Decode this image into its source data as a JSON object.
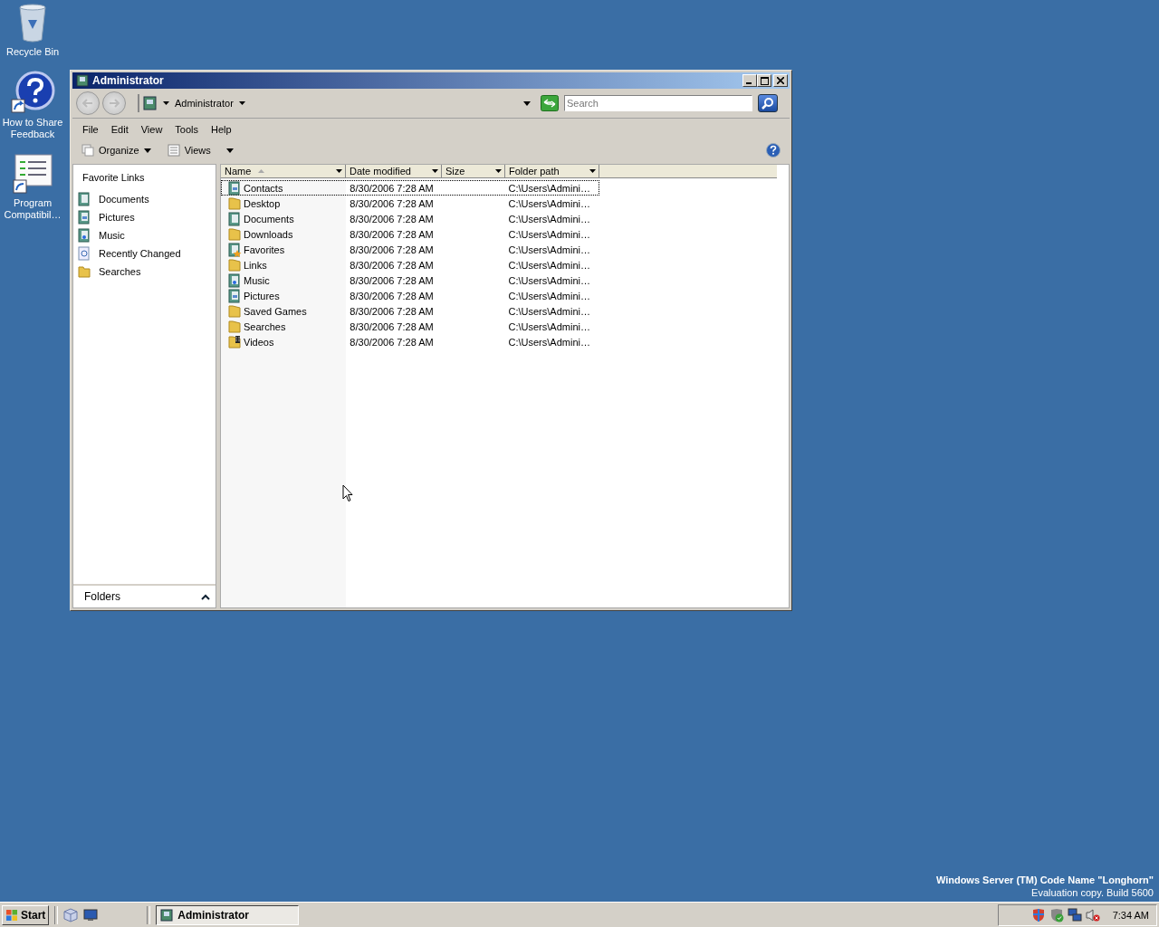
{
  "desktop_icons": [
    {
      "label": "Recycle Bin",
      "kind": "recycle"
    },
    {
      "label": "How to Share Feedback",
      "kind": "help"
    },
    {
      "label": "Program Compatibil…",
      "kind": "program"
    }
  ],
  "window": {
    "title": "Administrator",
    "address": {
      "crumb": "Administrator"
    },
    "search": {
      "placeholder": "Search"
    },
    "menu": [
      "File",
      "Edit",
      "View",
      "Tools",
      "Help"
    ],
    "toolbar": [
      "Organize",
      "Views"
    ],
    "favorite_links": {
      "title": "Favorite Links",
      "items": [
        {
          "label": "Documents",
          "kind": "documents"
        },
        {
          "label": "Pictures",
          "kind": "pictures"
        },
        {
          "label": "Music",
          "kind": "music"
        },
        {
          "label": "Recently Changed",
          "kind": "recent"
        },
        {
          "label": "Searches",
          "kind": "folder"
        }
      ]
    },
    "folders_panel": "Folders",
    "table": {
      "columns": [
        {
          "label": "Name",
          "sorted": true
        },
        {
          "label": "Date modified",
          "sorted": false
        },
        {
          "label": "Size",
          "sorted": false
        },
        {
          "label": "Folder path",
          "sorted": false
        }
      ],
      "rows": [
        {
          "name": "Contacts",
          "kind": "contacts",
          "date": "8/30/2006 7:28 AM",
          "path": "C:\\Users\\Admini…",
          "focused": true
        },
        {
          "name": "Desktop",
          "kind": "folder",
          "date": "8/30/2006 7:28 AM",
          "path": "C:\\Users\\Admini…",
          "focused": false
        },
        {
          "name": "Documents",
          "kind": "documents",
          "date": "8/30/2006 7:28 AM",
          "path": "C:\\Users\\Admini…",
          "focused": false
        },
        {
          "name": "Downloads",
          "kind": "folder",
          "date": "8/30/2006 7:28 AM",
          "path": "C:\\Users\\Admini…",
          "focused": false
        },
        {
          "name": "Favorites",
          "kind": "favorites",
          "date": "8/30/2006 7:28 AM",
          "path": "C:\\Users\\Admini…",
          "focused": false
        },
        {
          "name": "Links",
          "kind": "folder",
          "date": "8/30/2006 7:28 AM",
          "path": "C:\\Users\\Admini…",
          "focused": false
        },
        {
          "name": "Music",
          "kind": "music",
          "date": "8/30/2006 7:28 AM",
          "path": "C:\\Users\\Admini…",
          "focused": false
        },
        {
          "name": "Pictures",
          "kind": "pictures",
          "date": "8/30/2006 7:28 AM",
          "path": "C:\\Users\\Admini…",
          "focused": false
        },
        {
          "name": "Saved Games",
          "kind": "folder",
          "date": "8/30/2006 7:28 AM",
          "path": "C:\\Users\\Admini…",
          "focused": false
        },
        {
          "name": "Searches",
          "kind": "folder",
          "date": "8/30/2006 7:28 AM",
          "path": "C:\\Users\\Admini…",
          "focused": false
        },
        {
          "name": "Videos",
          "kind": "videos",
          "date": "8/30/2006 7:28 AM",
          "path": "C:\\Users\\Admini…",
          "focused": false
        }
      ]
    }
  },
  "os_notice": {
    "title": "Windows Server (TM) Code Name \"Longhorn\"",
    "subtitle": "Evaluation copy. Build 5600"
  },
  "taskbar": {
    "start": "Start",
    "tasks": [
      {
        "label": "Administrator",
        "selected": true
      }
    ],
    "clock": "7:34 AM"
  }
}
